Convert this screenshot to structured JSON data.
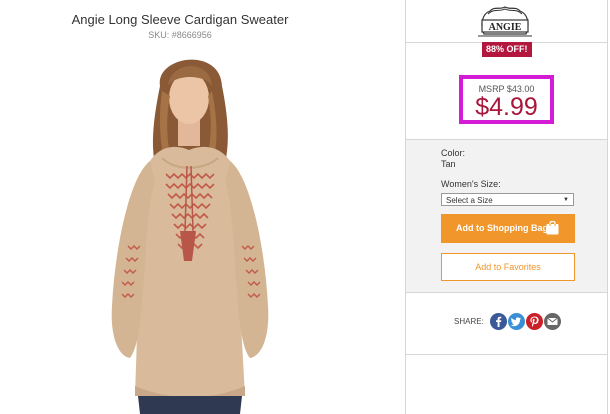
{
  "product": {
    "title": "Angie Long Sleeve Cardigan Sweater",
    "sku": "SKU: #8666956"
  },
  "brand": {
    "logo_text": "ANGIE",
    "discount_badge": "88% OFF!"
  },
  "pricing": {
    "msrp": "MSRP $43.00",
    "price": "$4.99"
  },
  "options": {
    "color_label": "Color:",
    "color_value": "Tan",
    "size_label": "Women's Size:",
    "size_selected": "Select a Size"
  },
  "actions": {
    "add_to_bag": "Add to Shopping Bag",
    "add_to_favorites": "Add to Favorites"
  },
  "share": {
    "label": "SHARE:",
    "icons": [
      "facebook-icon",
      "twitter-icon",
      "pinterest-icon",
      "email-icon"
    ]
  },
  "colors": {
    "accent_orange": "#f0962b",
    "price_red": "#a8173a",
    "badge_red": "#b4173e",
    "highlight_magenta": "#d41cd6"
  }
}
